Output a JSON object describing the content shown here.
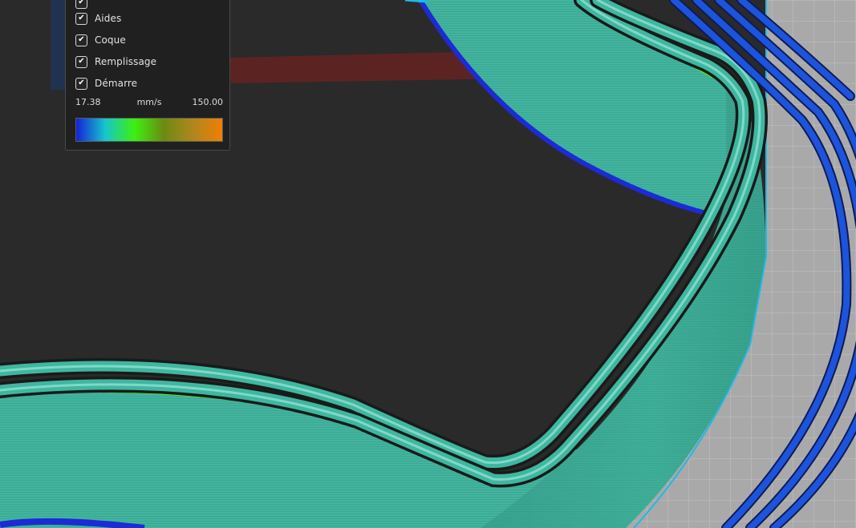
{
  "legend": {
    "items": [
      {
        "label": "",
        "checked": true
      },
      {
        "label": "Aides",
        "checked": true
      },
      {
        "label": "Coque",
        "checked": true
      },
      {
        "label": "Remplissage",
        "checked": true
      },
      {
        "label": "Démarre",
        "checked": true
      }
    ],
    "check_glyph": "✔",
    "scale": {
      "min": "17.38",
      "unit": "mm/s",
      "max": "150.00",
      "gradient_colors": [
        "#1522d8",
        "#17c7cc",
        "#3cf00e",
        "#6d8a12",
        "#b0861e",
        "#ef7f05"
      ]
    }
  },
  "colors": {
    "background": "#2a2a2a",
    "bed_grid": "#a9a9a9",
    "outer_perimeter_fast": "#1c54dc",
    "shell": "#3fb7a0",
    "slow_edge": "#1c2bd6",
    "infill_edge": "#5be31c",
    "support": "#5c2323"
  }
}
